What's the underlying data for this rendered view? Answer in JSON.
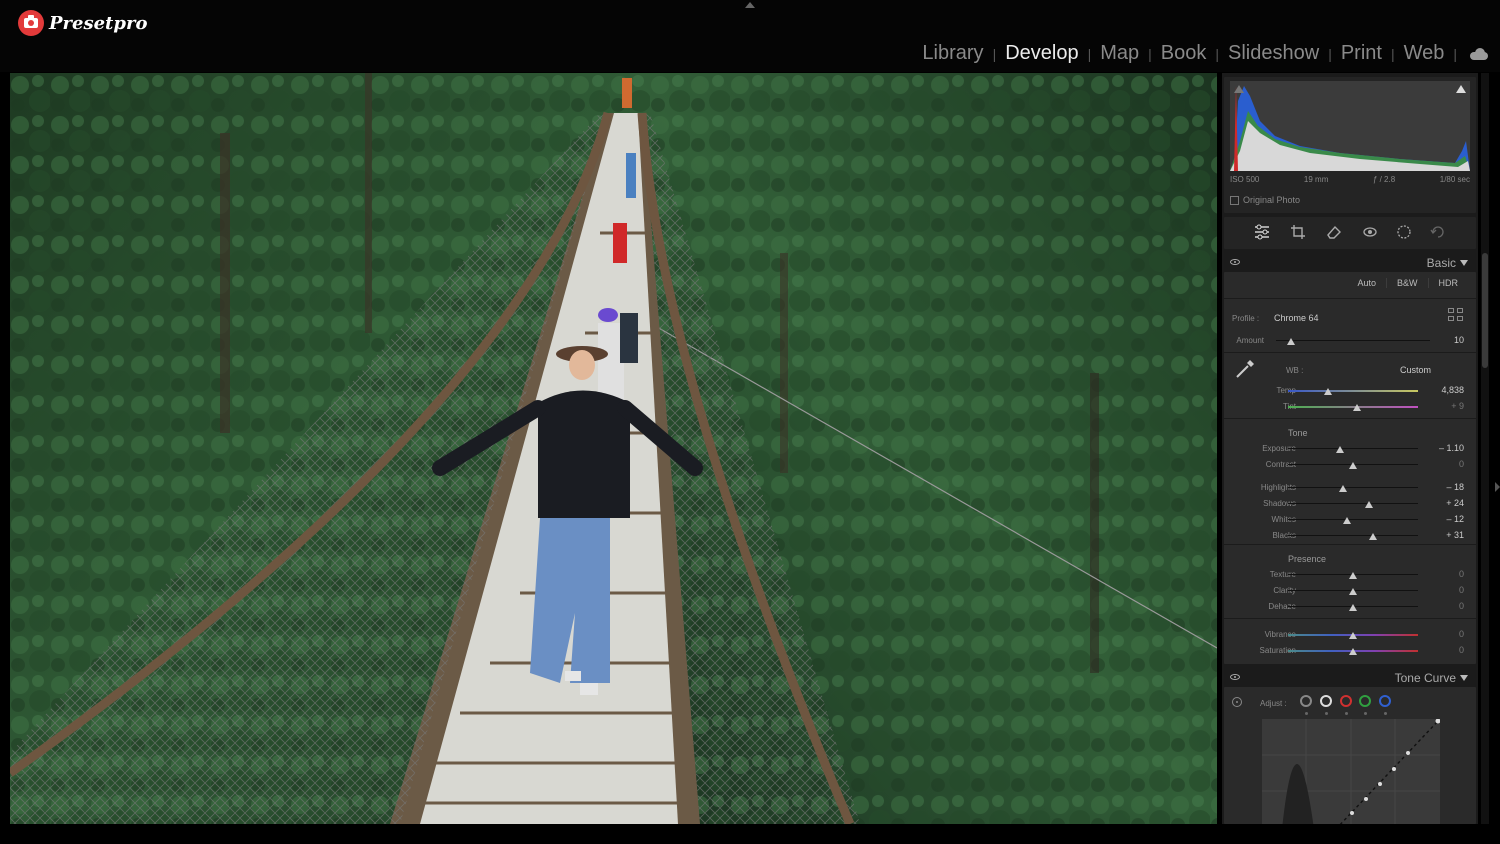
{
  "app": {
    "name": "Presetpro"
  },
  "modules": [
    {
      "label": "Library",
      "active": false
    },
    {
      "label": "Develop",
      "active": true
    },
    {
      "label": "Map",
      "active": false
    },
    {
      "label": "Book",
      "active": false
    },
    {
      "label": "Slideshow",
      "active": false
    },
    {
      "label": "Print",
      "active": false
    },
    {
      "label": "Web",
      "active": false
    }
  ],
  "cloud_icon": "cloud-icon",
  "histogram": {
    "iso": "ISO 500",
    "focal": "19 mm",
    "aperture": "ƒ / 2.8",
    "shutter": "1/80 sec",
    "original_photo": "Original Photo"
  },
  "tools": [
    "sliders-icon",
    "crop-icon",
    "eraser-icon",
    "red-eye-icon",
    "mask-icon",
    "history-icon"
  ],
  "basic": {
    "title": "Basic",
    "modes": [
      "Auto",
      "B&W",
      "HDR"
    ],
    "profile_label": "Profile :",
    "profile_value": "Chrome 64",
    "amount": {
      "label": "Amount",
      "value": "10",
      "level": 0.1
    },
    "wb_label": "WB :",
    "wb_value": "Custom",
    "temp": {
      "label": "Temp",
      "value": "4,838",
      "level": 0.31
    },
    "tint": {
      "label": "Tint",
      "value": "+ 9",
      "level": 0.53
    },
    "tone_title": "Tone",
    "exposure": {
      "label": "Exposure",
      "value": "– 1.10",
      "level": 0.4
    },
    "contrast": {
      "label": "Contrast",
      "value": "0",
      "level": 0.5
    },
    "highlights": {
      "label": "Highlights",
      "value": "– 18",
      "level": 0.42
    },
    "shadows": {
      "label": "Shadows",
      "value": "+ 24",
      "level": 0.62
    },
    "whites": {
      "label": "Whites",
      "value": "– 12",
      "level": 0.45
    },
    "blacks": {
      "label": "Blacks",
      "value": "+ 31",
      "level": 0.65
    },
    "presence_title": "Presence",
    "texture": {
      "label": "Texture",
      "value": "0",
      "level": 0.5
    },
    "clarity": {
      "label": "Clarity",
      "value": "0",
      "level": 0.5
    },
    "dehaze": {
      "label": "Dehaze",
      "value": "0",
      "level": 0.5
    },
    "vibrance": {
      "label": "Vibrance",
      "value": "0",
      "level": 0.5
    },
    "saturation": {
      "label": "Saturation",
      "value": "0",
      "level": 0.5
    }
  },
  "tone_curve": {
    "title": "Tone Curve",
    "adjust_label": "Adjust :",
    "channels": [
      "#888888",
      "#dddddd",
      "#d03030",
      "#30a040",
      "#3060d0"
    ]
  },
  "colors": {
    "accent": "#e23a3a",
    "panel": "#2a2a2a",
    "forest": "#2f5a35"
  }
}
